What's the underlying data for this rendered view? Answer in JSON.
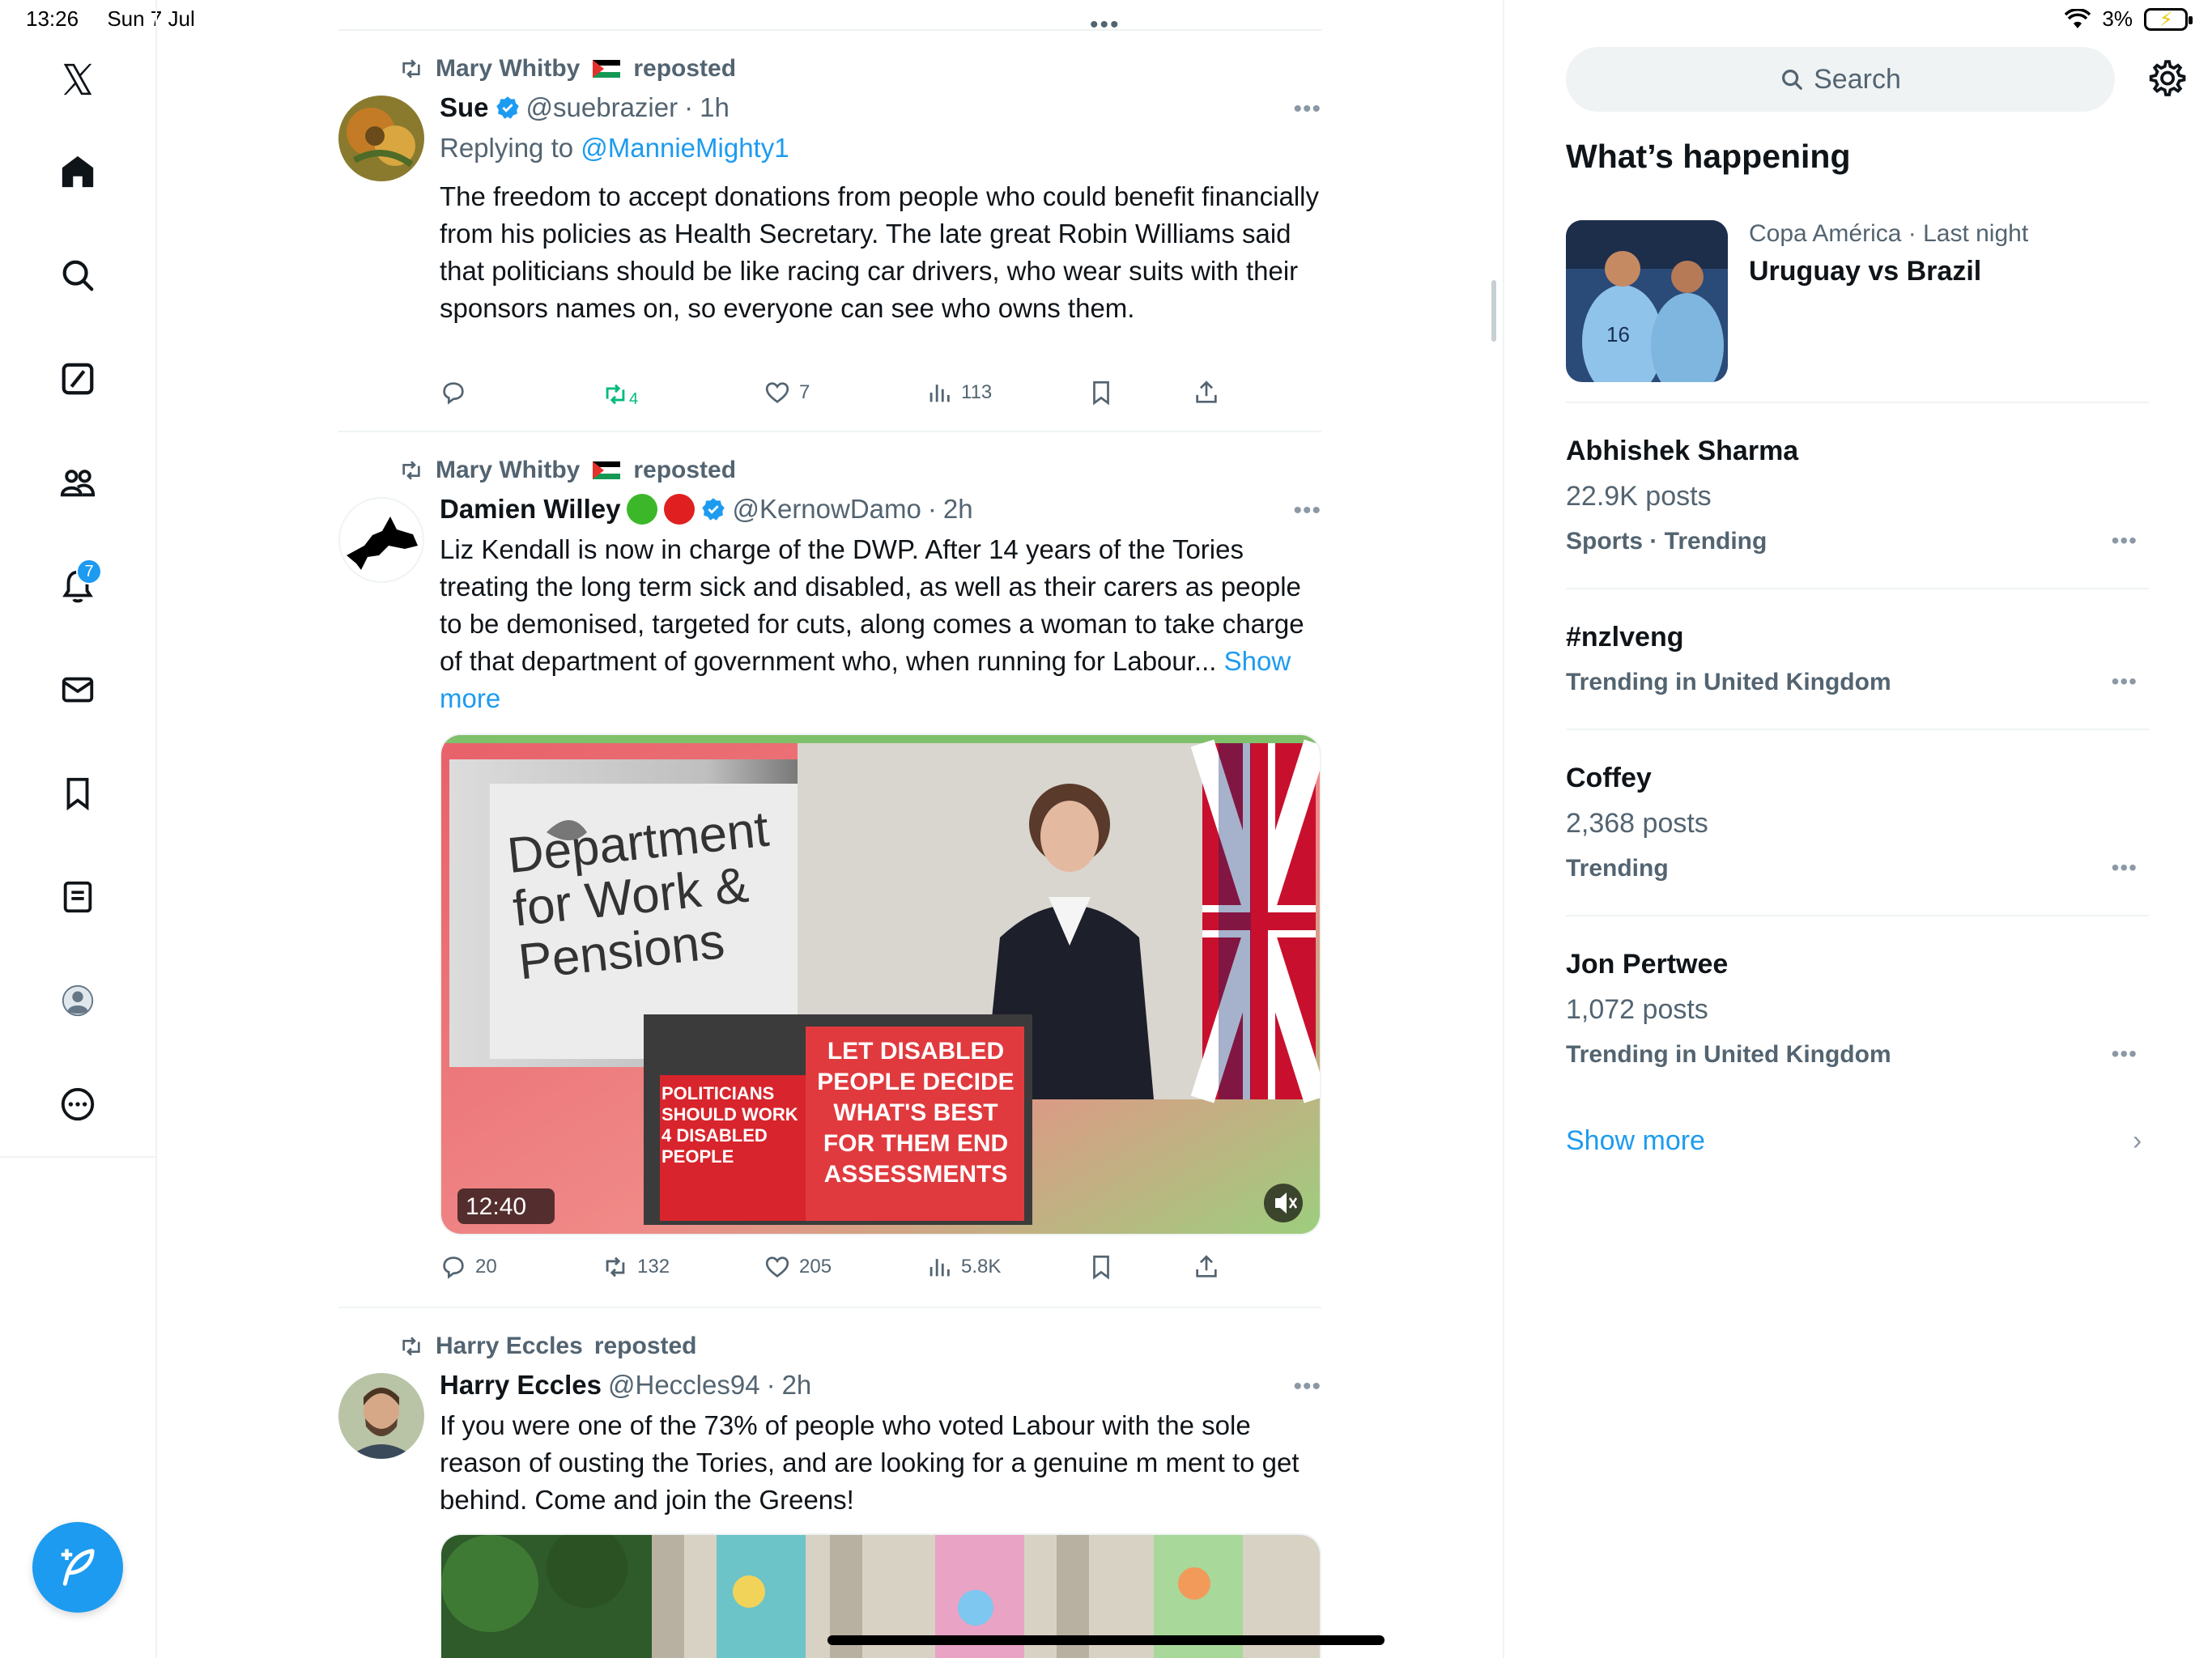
{
  "status_bar": {
    "time": "13:26",
    "date": "Sun 7 Jul",
    "battery": "3%"
  },
  "nav": {
    "notification_count": "7"
  },
  "feed": {
    "tweets": [
      {
        "repost_by": "Mary Whitby",
        "repost_suffix": "reposted",
        "name": "Sue",
        "handle": "@suebrazier",
        "time": "1h",
        "reply_label": "Replying to",
        "reply_to": "@MannieMighty1",
        "text": "The freedom to accept donations from people who could benefit financially from his policies as Health Secretary. The late great Robin Williams said that politicians should be like racing car drivers, who wear suits with their sponsors names on, so everyone can see who owns them.",
        "replies": "",
        "reposts": "4",
        "likes": "7",
        "views": "113"
      },
      {
        "repost_by": "Mary Whitby",
        "repost_suffix": "reposted",
        "name": "Damien Willey",
        "handle": "@KernowDamo",
        "time": "2h",
        "text": "Liz Kendall is now in charge of the DWP. After 14 years of the Tories treating the long term sick and disabled, as well as their carers as people to be demonised, targeted for cuts, along comes a woman to take charge of that department of government who, when running for Labour...",
        "show_more": "Show more",
        "video_duration": "12:40",
        "media_sign": [
          "Department",
          "for Work &",
          "Pensions"
        ],
        "banner_left": "POLITICIANS SHOULD WORK 4 DISABLED PEOPLE",
        "banner_right": "LET DISABLED PEOPLE DECIDE WHAT'S BEST FOR THEM END ASSESSMENTS",
        "replies": "20",
        "reposts": "132",
        "likes": "205",
        "views": "5.8K"
      },
      {
        "repost_by": "Harry Eccles",
        "repost_suffix": "reposted",
        "name": "Harry Eccles",
        "handle": "@Heccles94",
        "time": "2h",
        "text": "If you were one of the 73% of people who voted Labour with the sole reason of ousting the Tories, and are looking for a genuine m ment to get behind. Come and join the Greens!"
      }
    ]
  },
  "sidebar": {
    "search_placeholder": "Search",
    "title": "What’s happening",
    "featured": {
      "meta": "Copa América · Last night",
      "headline": "Uruguay vs Brazil"
    },
    "trends": [
      {
        "title": "Abhishek Sharma",
        "posts": "22.9K posts",
        "context": "Sports · Trending"
      },
      {
        "title": "#nzlveng",
        "posts": "",
        "context": "Trending in United Kingdom"
      },
      {
        "title": "Coffey",
        "posts": "2,368 posts",
        "context": "Trending"
      },
      {
        "title": "Jon Pertwee",
        "posts": "1,072 posts",
        "context": "Trending in United Kingdom"
      }
    ],
    "show_more": "Show more"
  },
  "colors": {
    "accent": "#1d9bf0",
    "repost_green": "#00ba7c",
    "muted": "#536471"
  }
}
